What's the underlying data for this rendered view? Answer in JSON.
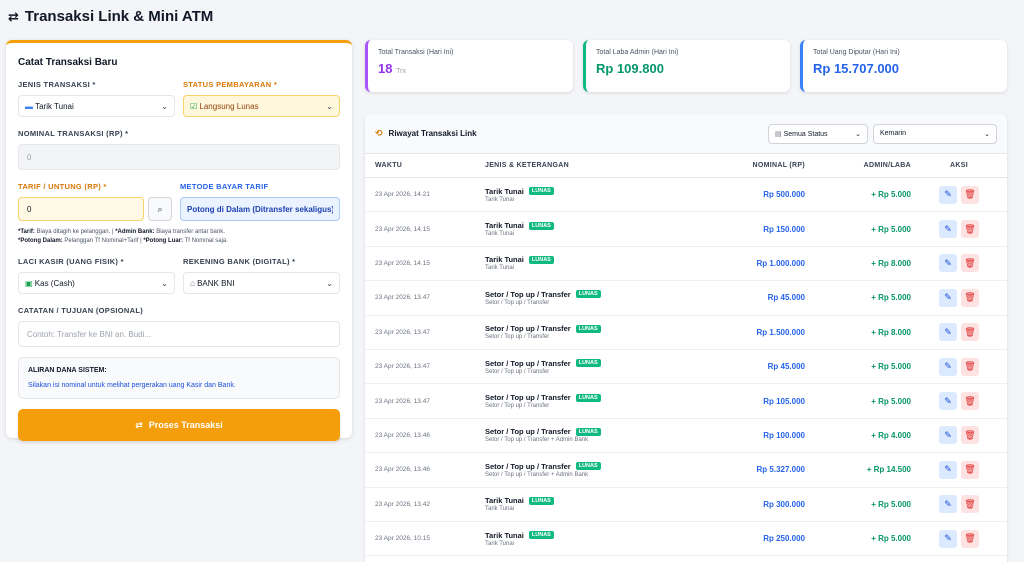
{
  "header": {
    "title": "Transaksi Link & Mini ATM",
    "icon": "arrows-exchange-icon"
  },
  "form": {
    "title": "Catat Transaksi Baru",
    "jenis_label": "JENIS TRANSAKSI *",
    "jenis_value": "Tarik Tunai",
    "status_label": "STATUS PEMBAYARAN *",
    "status_value": "Langsung Lunas",
    "nominal_label": "NOMINAL TRANSAKSI (RP) *",
    "nominal_value": "0",
    "tarif_label": "TARIF / UNTUNG (RP) *",
    "tarif_value": "0",
    "metode_label": "METODE BAYAR TARIF",
    "metode_value": "Potong di Dalam (Ditransfer sekaligus)",
    "note_tarif_b": "*Tarif:",
    "note_tarif": " Biaya ditagih ke pelanggan. | ",
    "note_admin_b": "*Admin Bank:",
    "note_admin": " Biaya transfer antar bank.",
    "note_dalam_b": "*Potong Dalam:",
    "note_dalam": " Pelanggan Tf Nominal+Tarif | ",
    "note_luar_b": "*Potong Luar:",
    "note_luar": " Tf Nominal saja.",
    "laci_label": "LACI KASIR (UANG FISIK) *",
    "laci_value": "Kas (Cash)",
    "rekening_label": "REKENING BANK (DIGITAL) *",
    "rekening_value": "BANK BNI",
    "catatan_label": "CATATAN / TUJUAN (OPSIONAL)",
    "catatan_placeholder": "Contoh: Transfer ke BNI an. Budi...",
    "aliran_title": "ALIRAN DANA SISTEM:",
    "aliran_desc": "Silakan isi nominal untuk melihat pergerakan uang Kasir dan Bank.",
    "submit_label": "Proses Transaksi"
  },
  "stats": [
    {
      "label": "Total Transaksi (Hari Ini)",
      "value": "18",
      "unit": "Trx"
    },
    {
      "label": "Total Laba Admin (Hari Ini)",
      "value": "Rp 109.800"
    },
    {
      "label": "Total Uang Diputar (Hari Ini)",
      "value": "Rp 15.707.000"
    }
  ],
  "history": {
    "title": "Riwayat Transaksi Link",
    "status_filter": "Semua Status",
    "date_filter": "Kemarin",
    "columns": [
      "WAKTU",
      "JENIS & KETERANGAN",
      "NOMINAL (RP)",
      "ADMIN/LABA",
      "AKSI"
    ],
    "rows": [
      {
        "time": "23 Apr 2026, 14.21",
        "type": "Tarik Tunai",
        "badge": "LUNAS",
        "desc": "Tarik Tunai",
        "nominal": "Rp 500.000",
        "admin": "+ Rp 5.000"
      },
      {
        "time": "23 Apr 2026, 14.15",
        "type": "Tarik Tunai",
        "badge": "LUNAS",
        "desc": "Tarik Tunai",
        "nominal": "Rp 150.000",
        "admin": "+ Rp 5.000"
      },
      {
        "time": "23 Apr 2026, 14.15",
        "type": "Tarik Tunai",
        "badge": "LUNAS",
        "desc": "Tarik Tunai",
        "nominal": "Rp 1.000.000",
        "admin": "+ Rp 8.000"
      },
      {
        "time": "23 Apr 2026, 13.47",
        "type": "Setor / Top up / Transfer",
        "badge": "LUNAS",
        "desc": "Setor / Top up / Transfer",
        "nominal": "Rp 45.000",
        "admin": "+ Rp 5.000"
      },
      {
        "time": "23 Apr 2026, 13.47",
        "type": "Setor / Top up / Transfer",
        "badge": "LUNAS",
        "desc": "Setor / Top up / Transfer",
        "nominal": "Rp 1.500.000",
        "admin": "+ Rp 8.000"
      },
      {
        "time": "23 Apr 2026, 13.47",
        "type": "Setor / Top up / Transfer",
        "badge": "LUNAS",
        "desc": "Setor / Top up / Transfer",
        "nominal": "Rp 45.000",
        "admin": "+ Rp 5.000"
      },
      {
        "time": "23 Apr 2026, 13.47",
        "type": "Setor / Top up / Transfer",
        "badge": "LUNAS",
        "desc": "Setor / Top up / Transfer",
        "nominal": "Rp 105.000",
        "admin": "+ Rp 5.000"
      },
      {
        "time": "23 Apr 2026, 13.46",
        "type": "Setor / Top up / Transfer",
        "badge": "LUNAS",
        "desc": "Setor / Top up / Transfer + Admin Bank",
        "nominal": "Rp 100.000",
        "admin": "+ Rp 4.000"
      },
      {
        "time": "23 Apr 2026, 13.46",
        "type": "Setor / Top up / Transfer",
        "badge": "LUNAS",
        "desc": "Setor / Top up / Transfer + Admin Bank",
        "nominal": "Rp 5.327.000",
        "admin": "+ Rp 14.500"
      },
      {
        "time": "23 Apr 2026, 13.42",
        "type": "Tarik Tunai",
        "badge": "LUNAS",
        "desc": "Tarik Tunai",
        "nominal": "Rp 300.000",
        "admin": "+ Rp 5.000"
      },
      {
        "time": "23 Apr 2026, 10.15",
        "type": "Tarik Tunai",
        "badge": "LUNAS",
        "desc": "Tarik Tunai",
        "nominal": "Rp 250.000",
        "admin": "+ Rp 5.000"
      }
    ]
  }
}
